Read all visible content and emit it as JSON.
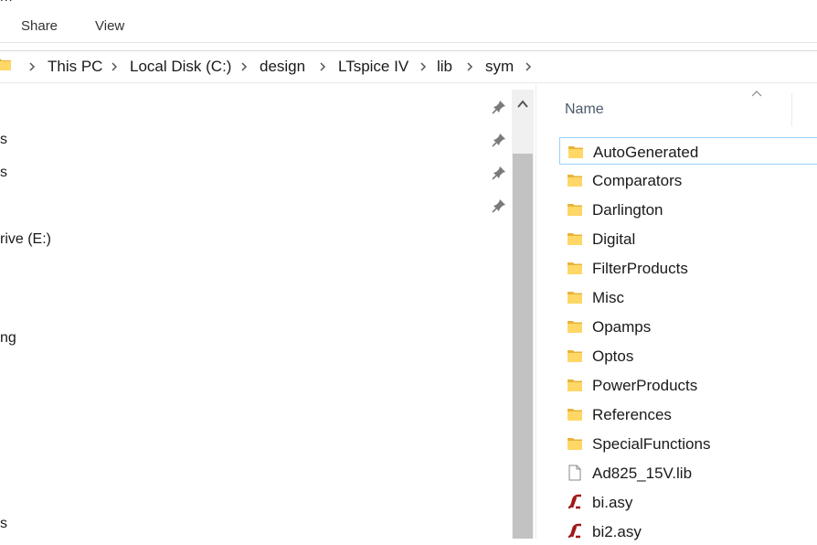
{
  "window": {
    "title_fragment": "m"
  },
  "ribbon": {
    "tabs": [
      "Share",
      "View"
    ]
  },
  "address": {
    "crumbs": [
      "This PC",
      "Local Disk (C:)",
      "design",
      "LTspice IV",
      "lib",
      "sym"
    ]
  },
  "nav": {
    "items": [
      "s",
      "s",
      "rive (E:)",
      "ng",
      "s"
    ]
  },
  "columns": {
    "name": "Name"
  },
  "files": [
    {
      "name": "AutoGenerated",
      "icon": "folder-icon"
    },
    {
      "name": "Comparators",
      "icon": "folder-icon"
    },
    {
      "name": "Darlington",
      "icon": "folder-icon"
    },
    {
      "name": "Digital",
      "icon": "folder-icon"
    },
    {
      "name": "FilterProducts",
      "icon": "folder-icon"
    },
    {
      "name": "Misc",
      "icon": "folder-icon"
    },
    {
      "name": "Opamps",
      "icon": "folder-icon"
    },
    {
      "name": "Optos",
      "icon": "folder-icon"
    },
    {
      "name": "PowerProducts",
      "icon": "folder-icon"
    },
    {
      "name": "References",
      "icon": "folder-icon"
    },
    {
      "name": "SpecialFunctions",
      "icon": "folder-icon"
    },
    {
      "name": "Ad825_15V.lib",
      "icon": "file-icon"
    },
    {
      "name": "bi.asy",
      "icon": "ltspice-symbol-icon"
    },
    {
      "name": "bi2.asy",
      "icon": "ltspice-symbol-icon"
    }
  ],
  "colors": {
    "folder": "#ffd766",
    "folder_dark": "#e8b33a",
    "selection_border": "#99d1ff",
    "lt_red": "#a01818"
  }
}
